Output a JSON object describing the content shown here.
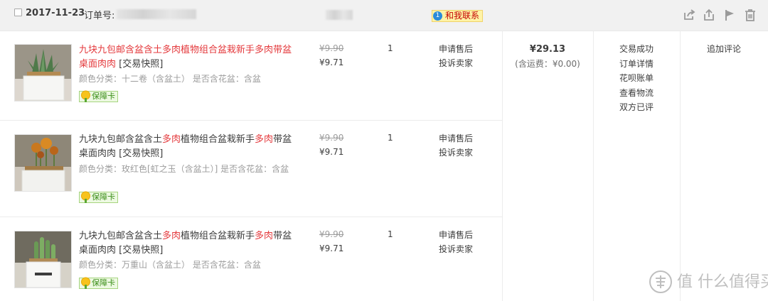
{
  "order": {
    "date": "2017-11-23",
    "order_no_label": "订单号:",
    "contact_label": "和我联系",
    "contact_icon_text": "1",
    "icons": [
      "share-icon",
      "export-icon",
      "flag-icon",
      "trash-icon"
    ]
  },
  "items": [
    {
      "title_parts": [
        {
          "text": "九块九包邮含盆含土",
          "hl": true
        },
        {
          "text": "多肉",
          "hl": true
        },
        {
          "text": "植物组合盆栽新手",
          "hl": true
        },
        {
          "text": "多肉",
          "hl": true
        },
        {
          "text": "带盆桌面肉肉",
          "hl": true
        }
      ],
      "snapshot": "[交易快照]",
      "sku": "颜色分类：十二卷（含盆土）   是否含花盆：含盆",
      "badge": "保障卡",
      "price_original": "¥9.90",
      "price_now": "¥9.71",
      "qty": "1",
      "actions": [
        "申请售后",
        "投诉卖家"
      ]
    },
    {
      "title_parts": [
        {
          "text": "九块九包邮含盆含土",
          "hl": false
        },
        {
          "text": "多肉",
          "hl": true
        },
        {
          "text": "植物组合盆栽新手",
          "hl": false
        },
        {
          "text": "多肉",
          "hl": true
        },
        {
          "text": "带盆桌面肉肉",
          "hl": false
        }
      ],
      "snapshot": "[交易快照]",
      "sku": "颜色分类：玫红色[虹之玉（含盆土）]   是否含花盆：含盆",
      "badge": "保障卡",
      "price_original": "¥9.90",
      "price_now": "¥9.71",
      "qty": "1",
      "actions": [
        "申请售后",
        "投诉卖家"
      ]
    },
    {
      "title_parts": [
        {
          "text": "九块九包邮含盆含土",
          "hl": false
        },
        {
          "text": "多肉",
          "hl": true
        },
        {
          "text": "植物组合盆栽新手",
          "hl": false
        },
        {
          "text": "多肉",
          "hl": true
        },
        {
          "text": "带盆桌面肉肉",
          "hl": false
        }
      ],
      "snapshot": "[交易快照]",
      "sku": "颜色分类：万重山（含盆土）   是否含花盆：含盆",
      "badge": "保障卡",
      "price_original": "¥9.90",
      "price_now": "¥9.71",
      "qty": "1",
      "actions": [
        "申请售后",
        "投诉卖家"
      ]
    }
  ],
  "summary": {
    "total": "¥29.13",
    "shipping": "(含运费：¥0.00)"
  },
  "status_links": [
    "交易成功",
    "订单详情",
    "花呗账单",
    "查看物流",
    "双方已评"
  ],
  "review_link": "追加评论",
  "watermark": "值 什么值得买",
  "colors": {
    "highlight": "#e4393c",
    "header_bg": "#f1f1f1",
    "badge_bg": "#edf9e2",
    "contact_bg": "#fff3a6"
  }
}
